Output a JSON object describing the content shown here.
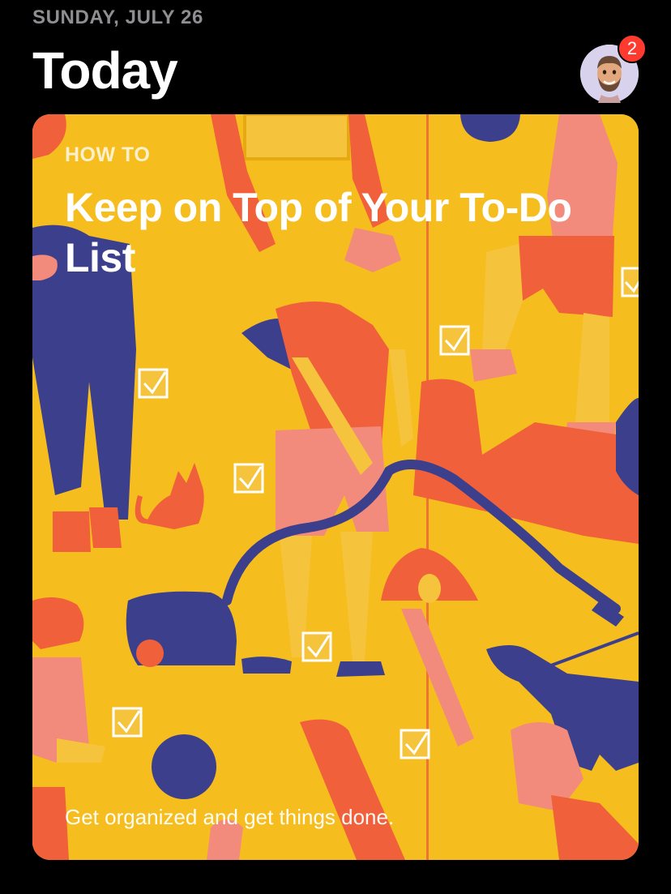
{
  "header": {
    "date": "SUNDAY, JULY 26",
    "title": "Today",
    "avatar_icon": "memoji-avatar",
    "badge_count": "2"
  },
  "card": {
    "eyebrow": "HOW TO",
    "title": "Keep on Top of Your To-Do List",
    "subtitle": "Get organized and get things done.",
    "illustration": "paper-cut illustration of people doing chores with checkboxes"
  },
  "colors": {
    "background": "#000000",
    "card_yellow": "#f6bd1e",
    "navy": "#3b3f8c",
    "coral": "#f0603a",
    "pink": "#f08a8a",
    "badge_red": "#ff3b30",
    "avatar_bg": "#d9d2ec"
  }
}
